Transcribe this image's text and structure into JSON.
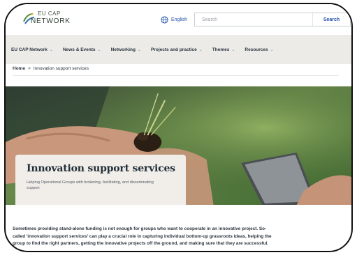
{
  "header": {
    "logo_line1": "EU CAP",
    "logo_line2": "NETWORK",
    "language": "English",
    "search_placeholder": "Search",
    "search_button": "Search"
  },
  "nav": {
    "items": [
      {
        "label": "EU CAP Network"
      },
      {
        "label": "News & Events"
      },
      {
        "label": "Networking"
      },
      {
        "label": "Projects and practice"
      },
      {
        "label": "Themes"
      },
      {
        "label": "Resources"
      }
    ]
  },
  "breadcrumb": {
    "home": "Home",
    "separator": ">",
    "current": "Innovation support services"
  },
  "hero": {
    "title": "Innovation support services",
    "subtitle": "Helping Operational Groups with brokering, facilitating, and disseminating support"
  },
  "intro": {
    "text": "Sometimes providing stand-alone funding is not enough for groups who want to cooperate in an innovative project. So-called 'innovation support services' can play a crucial role in capturing individual bottom-up grassroots ideas, helping the group to find the right partners, getting the innovative projects off the ground, and making sure that they are successful."
  },
  "colors": {
    "accent_blue": "#2452a8",
    "nav_bg": "#ecebe7",
    "card_bg": "#f1ede9",
    "text_dark": "#22303a"
  },
  "icons": {
    "language": "globe-icon",
    "nav_chevron": "chevron-down-icon"
  }
}
